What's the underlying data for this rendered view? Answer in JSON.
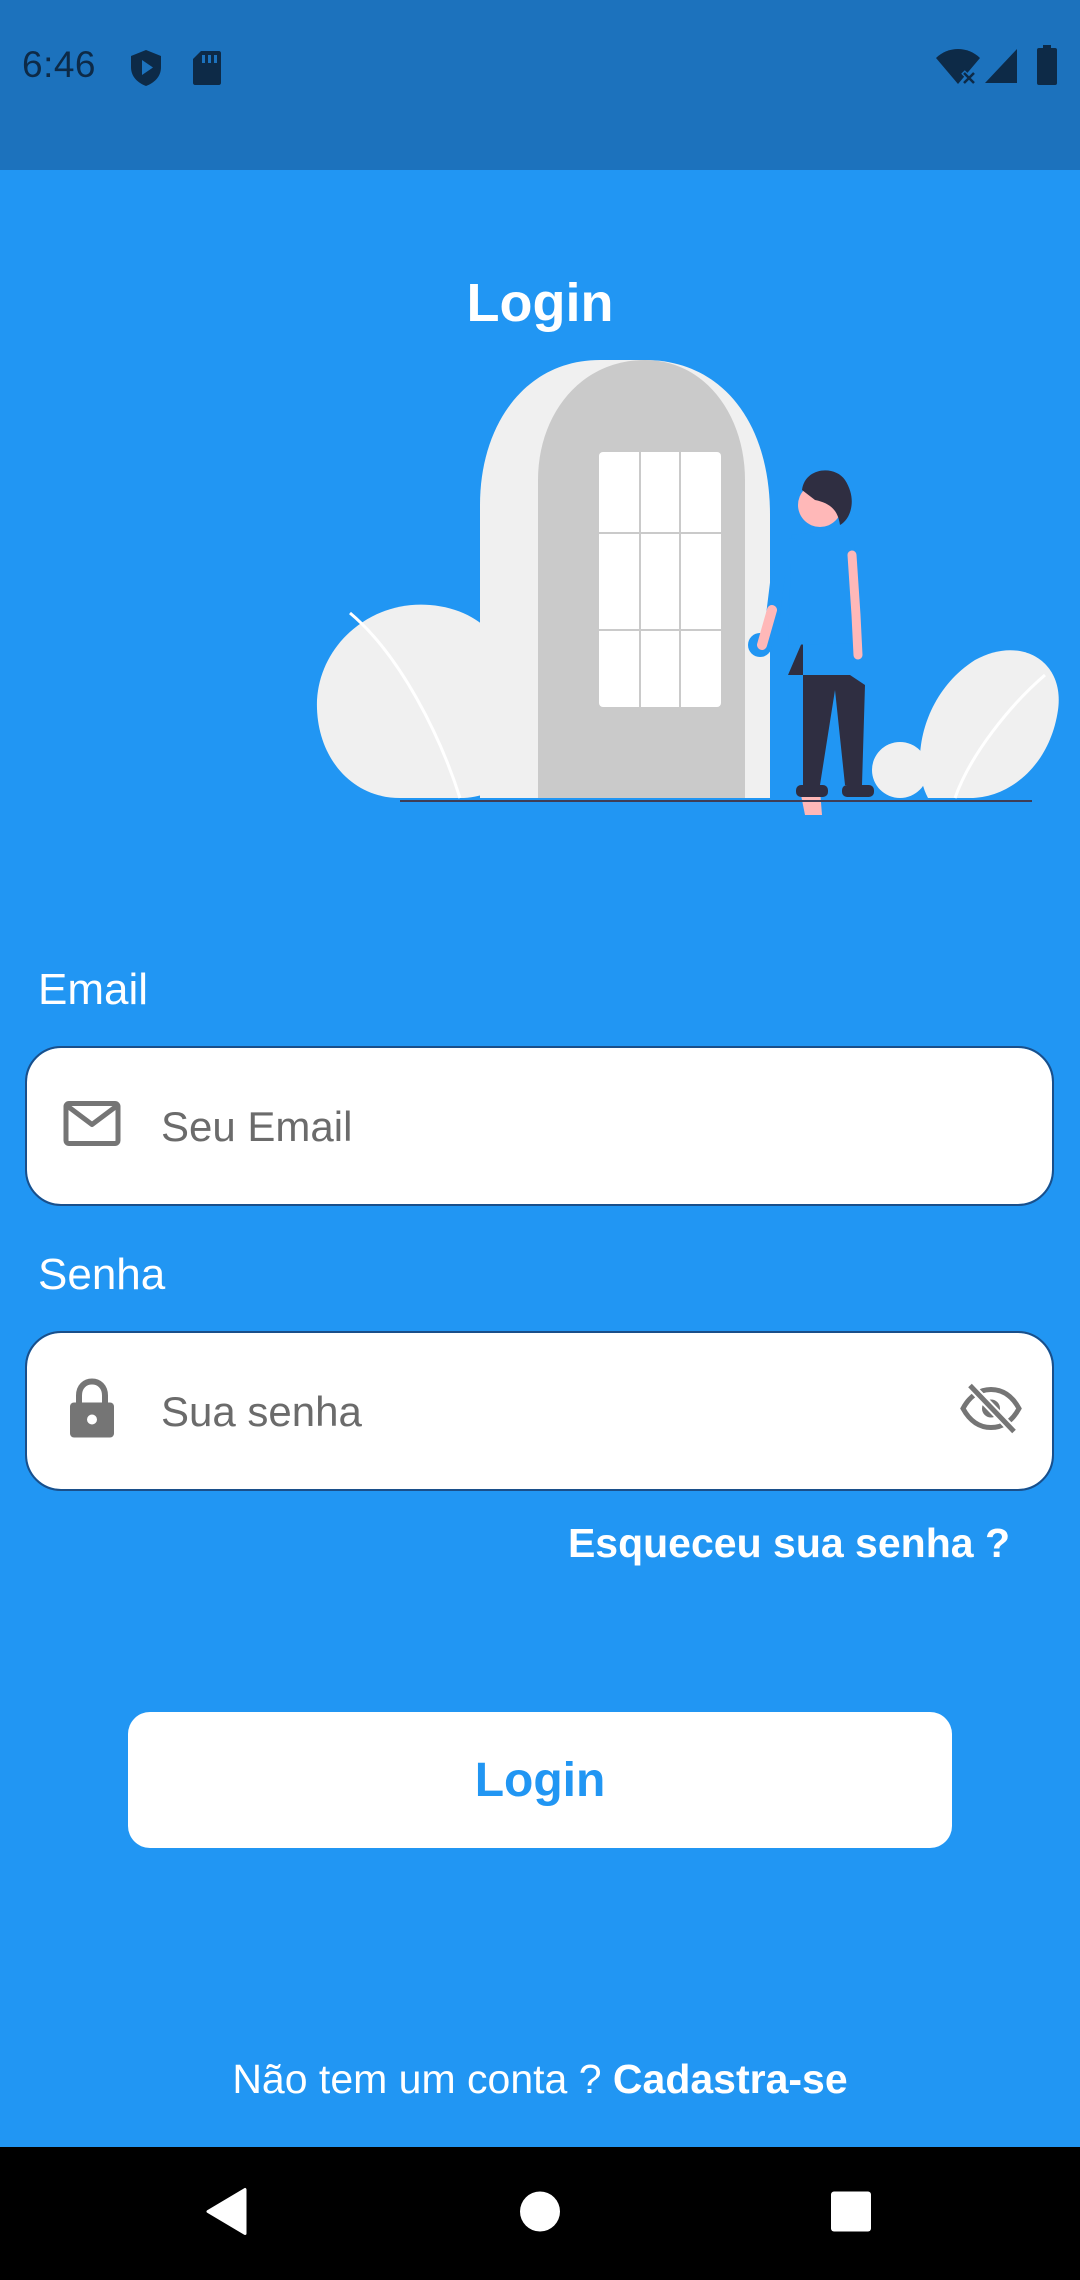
{
  "status_bar": {
    "time": "6:46"
  },
  "page": {
    "title": "Login"
  },
  "email": {
    "label": "Email",
    "placeholder": "Seu Email",
    "value": ""
  },
  "password": {
    "label": "Senha",
    "placeholder": "Sua senha",
    "value": ""
  },
  "forgot_password": "Esqueceu sua senha ?",
  "login_button": "Login",
  "signup": {
    "prompt": "Não tem um conta ?",
    "link": "Cadastra-se"
  },
  "colors": {
    "background": "#2196F3",
    "status_bar": "#1C72BD",
    "accent": "#2196F3",
    "surface": "#FFFFFF"
  },
  "icons": {
    "status": [
      "shield-play-icon",
      "sd-card-icon",
      "wifi-off-icon",
      "cell-signal-icon",
      "battery-icon"
    ],
    "email_field": "envelope-icon",
    "password_field": "lock-icon",
    "password_toggle": "eye-off-icon",
    "navigation": [
      "back-triangle-icon",
      "home-circle-icon",
      "recents-square-icon"
    ]
  }
}
